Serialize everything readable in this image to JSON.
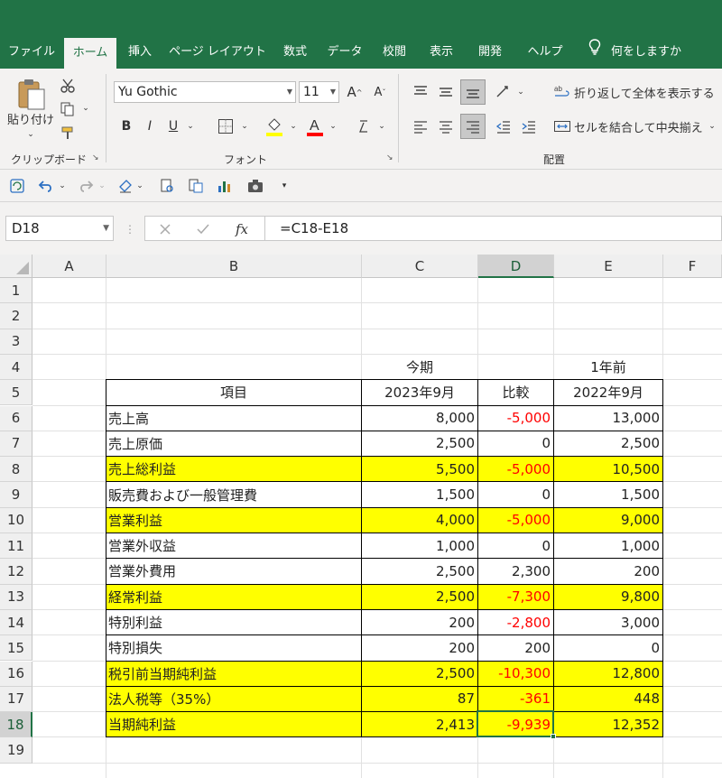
{
  "ribbon_tabs": [
    "ファイル",
    "ホーム",
    "挿入",
    "ページ レイアウト",
    "数式",
    "データ",
    "校閲",
    "表示",
    "開発",
    "ヘルプ",
    "何をしますか"
  ],
  "active_tab": "ホーム",
  "clipboard": {
    "paste_label": "貼り付け",
    "group_label": "クリップボード"
  },
  "font": {
    "name": "Yu Gothic",
    "size": "11",
    "group_label": "フォント",
    "bold": "B",
    "italic": "I",
    "underline": "U"
  },
  "alignment": {
    "wrap_label": "折り返して全体を表示する",
    "merge_label": "セルを結合して中央揃え",
    "group_label": "配置"
  },
  "name_box": "D18",
  "formula": "=C18-E18",
  "fx_label": "fx",
  "columns": [
    "A",
    "B",
    "C",
    "D",
    "E",
    "F"
  ],
  "selected_column": "D",
  "rows": [
    "1",
    "2",
    "3",
    "4",
    "5",
    "6",
    "7",
    "8",
    "9",
    "10",
    "11",
    "12",
    "13",
    "14",
    "15",
    "16",
    "17",
    "18",
    "19"
  ],
  "selected_row": "18",
  "labels": {
    "c4": "今期",
    "e4": "1年前"
  },
  "table_header": [
    "項目",
    "2023年9月",
    "比較",
    "2022年9月"
  ],
  "table_rows": [
    {
      "item": "売上高",
      "current": "8,000",
      "diff": "-5,000",
      "prior": "13,000",
      "highlight": false,
      "negative": true
    },
    {
      "item": "売上原価",
      "current": "2,500",
      "diff": "0",
      "prior": "2,500",
      "highlight": false,
      "negative": false
    },
    {
      "item": "売上総利益",
      "current": "5,500",
      "diff": "-5,000",
      "prior": "10,500",
      "highlight": true,
      "negative": true
    },
    {
      "item": "販売費および一般管理費",
      "current": "1,500",
      "diff": "0",
      "prior": "1,500",
      "highlight": false,
      "negative": false
    },
    {
      "item": "営業利益",
      "current": "4,000",
      "diff": "-5,000",
      "prior": "9,000",
      "highlight": true,
      "negative": true
    },
    {
      "item": "営業外収益",
      "current": "1,000",
      "diff": "0",
      "prior": "1,000",
      "highlight": false,
      "negative": false
    },
    {
      "item": "営業外費用",
      "current": "2,500",
      "diff": "2,300",
      "prior": "200",
      "highlight": false,
      "negative": false
    },
    {
      "item": "経常利益",
      "current": "2,500",
      "diff": "-7,300",
      "prior": "9,800",
      "highlight": true,
      "negative": true
    },
    {
      "item": "特別利益",
      "current": "200",
      "diff": "-2,800",
      "prior": "3,000",
      "highlight": false,
      "negative": true
    },
    {
      "item": "特別損失",
      "current": "200",
      "diff": "200",
      "prior": "0",
      "highlight": false,
      "negative": false
    },
    {
      "item": "税引前当期純利益",
      "current": "2,500",
      "diff": "-10,300",
      "prior": "12,800",
      "highlight": true,
      "negative": true
    },
    {
      "item": "法人税等（35%）",
      "current": "87",
      "diff": "-361",
      "prior": "448",
      "highlight": true,
      "negative": true
    },
    {
      "item": "当期純利益",
      "current": "2,413",
      "diff": "-9,939",
      "prior": "12,352",
      "highlight": true,
      "negative": true
    }
  ],
  "colors": {
    "excel_green": "#217346",
    "highlight": "#ffff00",
    "negative": "#ff0000"
  }
}
